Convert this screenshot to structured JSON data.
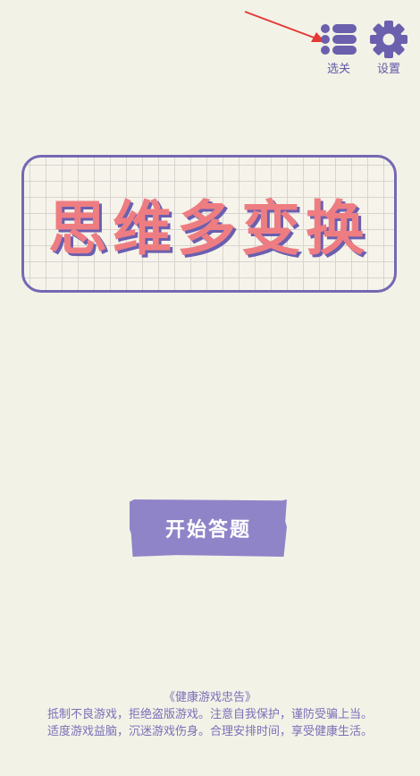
{
  "header": {
    "levels_label": "选关",
    "settings_label": "设置"
  },
  "title_card": {
    "title": "思维多变换"
  },
  "start_button": {
    "label": "开始答题"
  },
  "notice": {
    "heading": "《健康游戏忠告》",
    "line1": "抵制不良游戏，拒绝盗版游戏。注意自我保护，谨防受骗上当。",
    "line2": "适度游戏益脑，沉迷游戏伤身。合理安排时间，享受健康生活。"
  },
  "colors": {
    "background": "#f3f2e7",
    "accent_purple": "#7568b3",
    "title_pink": "#ee7d82",
    "button_purple": "#8f84c8",
    "annotation_red": "#e53935"
  }
}
